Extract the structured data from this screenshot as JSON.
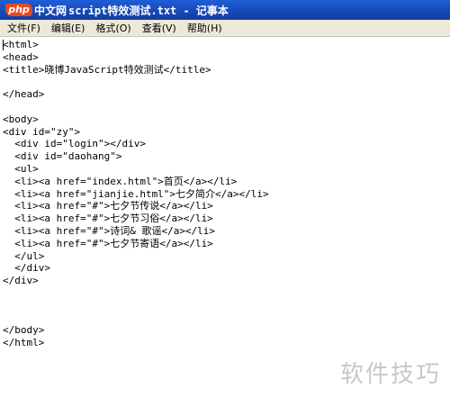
{
  "window": {
    "title_suffix": "script特效测试.txt - 记事本"
  },
  "logo": {
    "mark_text": "php",
    "name_text": "中文网"
  },
  "menu": [
    "文件(F)",
    "编辑(E)",
    "格式(O)",
    "查看(V)",
    "帮助(H)"
  ],
  "document": {
    "lines": [
      "<html>",
      "<head>",
      "<title>晓博JavaScript特效测试</title>",
      "",
      "</head>",
      "",
      "<body>",
      "<div id=\"zy\">",
      "  <div id=\"login\"></div>",
      "  <div id=\"daohang\">",
      "  <ul>",
      "  <li><a href=\"index.html\">首页</a></li>",
      "  <li><a href=\"jianjie.html\">七夕简介</a></li>",
      "  <li><a href=\"#\">七夕节传说</a></li>",
      "  <li><a href=\"#\">七夕节习俗</a></li>",
      "  <li><a href=\"#\">诗词& 歌谣</a></li>",
      "  <li><a href=\"#\">七夕节寄语</a></li>",
      "  </ul>",
      "  </div>",
      "</div>",
      "",
      "",
      "",
      "</body>",
      "</html>"
    ]
  },
  "watermark": {
    "text": "软件技巧"
  },
  "colors": {
    "titlebar": "#1749b8",
    "menubar": "#ece9d8",
    "logo_accent": "#e84a1c"
  }
}
